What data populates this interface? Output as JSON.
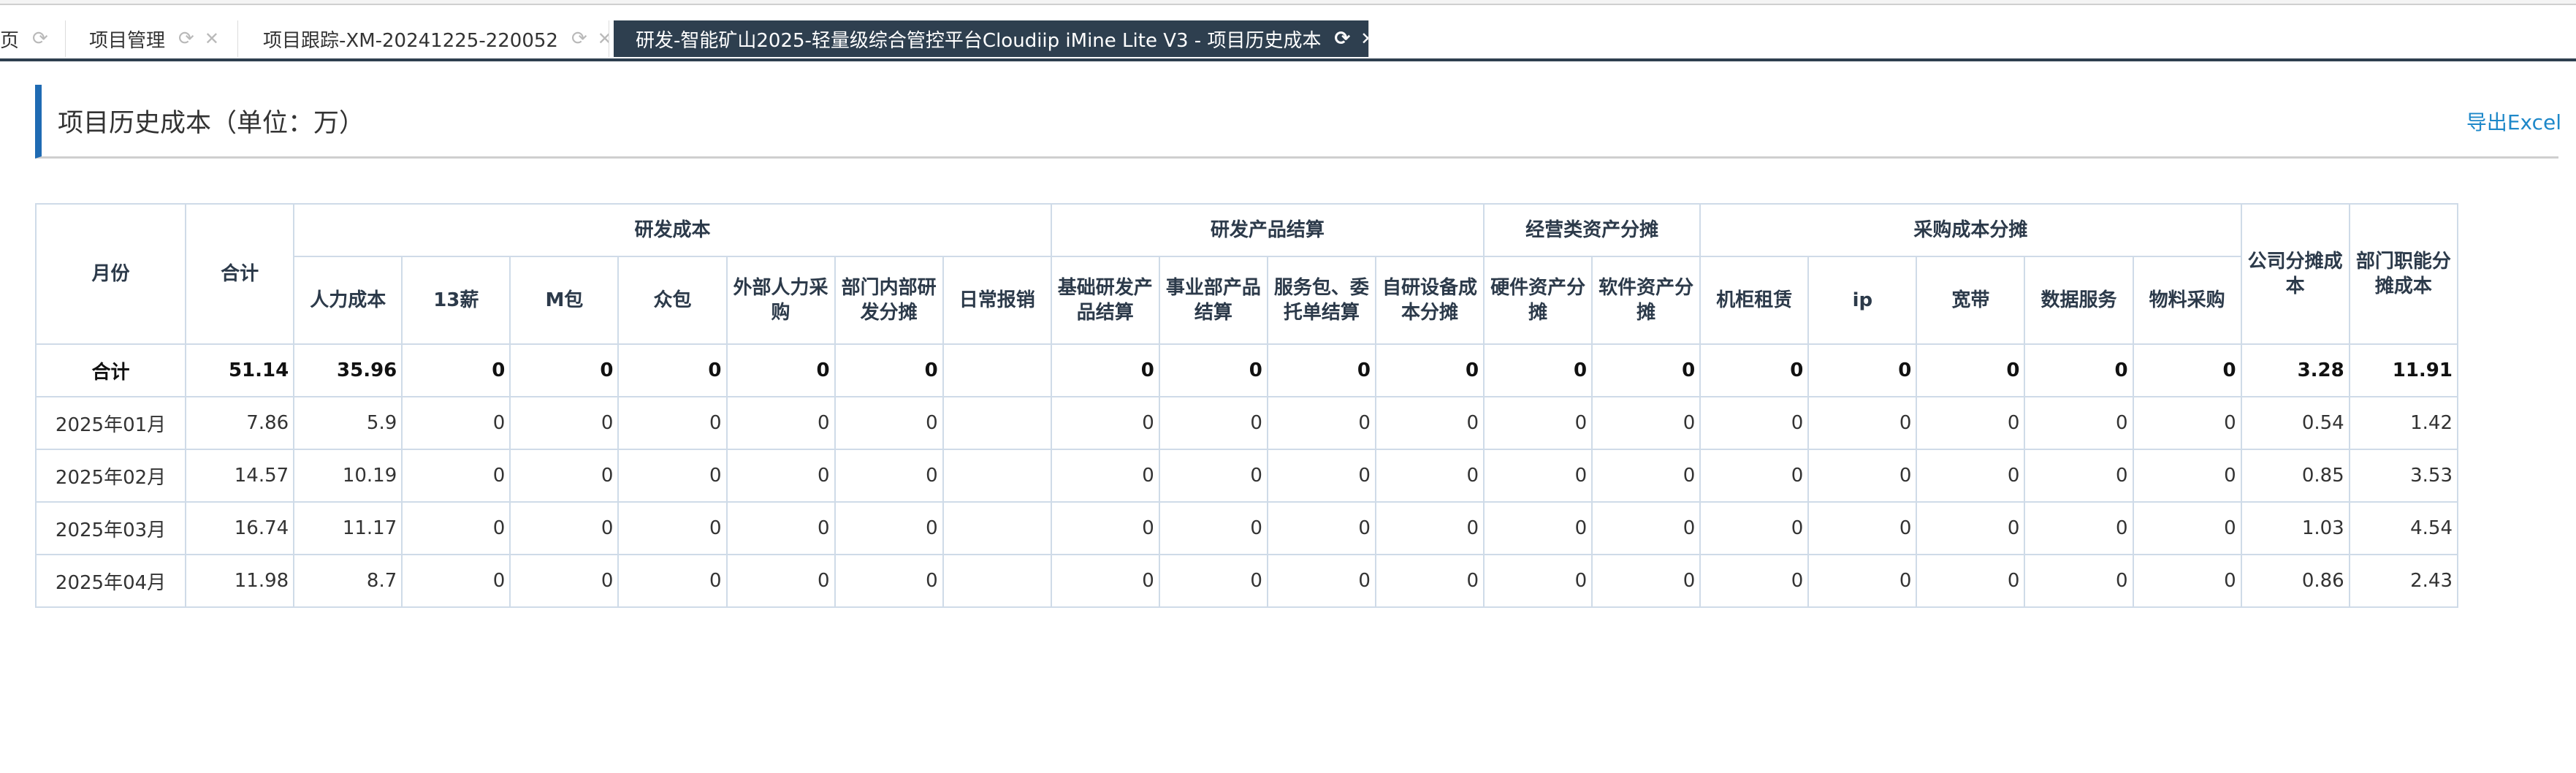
{
  "tabs": [
    {
      "label": "页",
      "has_refresh": true,
      "has_close": false
    },
    {
      "label": "项目管理",
      "has_refresh": true,
      "has_close": true
    },
    {
      "label": "项目跟踪-XM-20241225-220052",
      "has_refresh": true,
      "has_close": true
    },
    {
      "label": "研发-智能矿山2025-轻量级综合管控平台Cloudiip iMine Lite V3 - 项目历史成本",
      "has_refresh": true,
      "has_close": true,
      "active": true
    }
  ],
  "icons": {
    "refresh": "⟳",
    "close": "✕"
  },
  "page": {
    "title": "项目历史成本（单位：万）",
    "export_label": "导出Excel"
  },
  "colors": {
    "active_tab": "#2e3f4f",
    "title_accent": "#1f6bb3",
    "link": "#1e88c9",
    "table_border": "#cfdbe8"
  },
  "table": {
    "headers": {
      "month": "月份",
      "total": "合计",
      "groups": [
        "研发成本",
        "研发产品结算",
        "经营类资产分摊",
        "采购成本分摊"
      ],
      "company_share": "公司分摊成本",
      "dept_share": "部门职能分摊成本",
      "sub": {
        "rd": [
          "人力成本",
          "13薪",
          "M包",
          "众包",
          "外部人力采购",
          "部门内部研发分摊",
          "日常报销"
        ],
        "product": [
          "基础研发产品结算",
          "事业部产品结算",
          "服务包、委托单结算",
          "自研设备成本分摊"
        ],
        "assets": [
          "硬件资产分摊",
          "软件资产分摊"
        ],
        "purchase": [
          "机柜租赁",
          "ip",
          "宽带",
          "数据服务",
          "物料采购"
        ]
      }
    },
    "rows": [
      {
        "month": "合计",
        "total": "51.14",
        "cells": [
          "35.96",
          "0",
          "0",
          "0",
          "0",
          "0",
          "",
          "0",
          "0",
          "0",
          "0",
          "0",
          "0",
          "0",
          "0",
          "0",
          "0",
          "0"
        ],
        "company": "3.28",
        "dept": "11.91"
      },
      {
        "month": "2025年01月",
        "total": "7.86",
        "cells": [
          "5.9",
          "0",
          "0",
          "0",
          "0",
          "0",
          "",
          "0",
          "0",
          "0",
          "0",
          "0",
          "0",
          "0",
          "0",
          "0",
          "0",
          "0"
        ],
        "company": "0.54",
        "dept": "1.42"
      },
      {
        "month": "2025年02月",
        "total": "14.57",
        "cells": [
          "10.19",
          "0",
          "0",
          "0",
          "0",
          "0",
          "",
          "0",
          "0",
          "0",
          "0",
          "0",
          "0",
          "0",
          "0",
          "0",
          "0",
          "0"
        ],
        "company": "0.85",
        "dept": "3.53"
      },
      {
        "month": "2025年03月",
        "total": "16.74",
        "cells": [
          "11.17",
          "0",
          "0",
          "0",
          "0",
          "0",
          "",
          "0",
          "0",
          "0",
          "0",
          "0",
          "0",
          "0",
          "0",
          "0",
          "0",
          "0"
        ],
        "company": "1.03",
        "dept": "4.54"
      },
      {
        "month": "2025年04月",
        "total": "11.98",
        "cells": [
          "8.7",
          "0",
          "0",
          "0",
          "0",
          "0",
          "",
          "0",
          "0",
          "0",
          "0",
          "0",
          "0",
          "0",
          "0",
          "0",
          "0",
          "0"
        ],
        "company": "0.86",
        "dept": "2.43"
      }
    ]
  }
}
